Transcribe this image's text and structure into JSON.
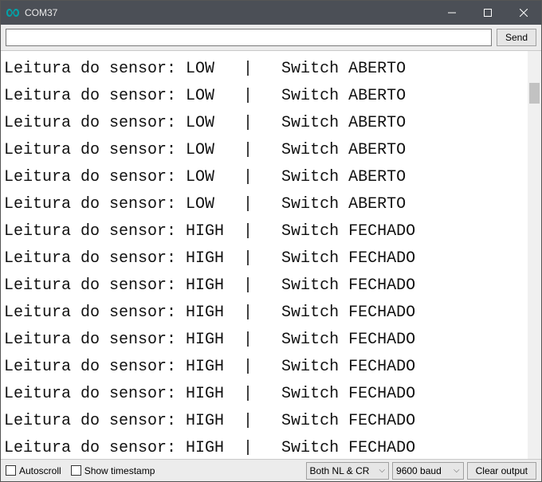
{
  "window": {
    "title": "COM37"
  },
  "toolbar": {
    "input_value": "",
    "input_placeholder": "",
    "send_label": "Send"
  },
  "console": {
    "lines": [
      "Leitura do sensor: LOW   |   Switch ABERTO",
      "Leitura do sensor: LOW   |   Switch ABERTO",
      "Leitura do sensor: LOW   |   Switch ABERTO",
      "Leitura do sensor: LOW   |   Switch ABERTO",
      "Leitura do sensor: LOW   |   Switch ABERTO",
      "Leitura do sensor: LOW   |   Switch ABERTO",
      "Leitura do sensor: HIGH  |   Switch FECHADO",
      "Leitura do sensor: HIGH  |   Switch FECHADO",
      "Leitura do sensor: HIGH  |   Switch FECHADO",
      "Leitura do sensor: HIGH  |   Switch FECHADO",
      "Leitura do sensor: HIGH  |   Switch FECHADO",
      "Leitura do sensor: HIGH  |   Switch FECHADO",
      "Leitura do sensor: HIGH  |   Switch FECHADO",
      "Leitura do sensor: HIGH  |   Switch FECHADO",
      "Leitura do sensor: HIGH  |   Switch FECHADO"
    ]
  },
  "footer": {
    "autoscroll_label": "Autoscroll",
    "autoscroll_checked": false,
    "timestamp_label": "Show timestamp",
    "timestamp_checked": false,
    "line_ending_selected": "Both NL & CR",
    "baud_selected": "9600 baud",
    "clear_label": "Clear output"
  }
}
